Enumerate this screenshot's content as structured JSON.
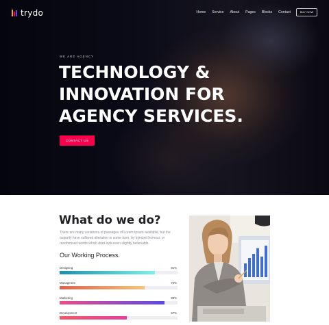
{
  "brand": {
    "name": "trydo",
    "mark_colors": [
      "#f5a524",
      "#f9004d",
      "#6a3cff"
    ]
  },
  "nav": {
    "items": [
      "Home",
      "Service",
      "About",
      "Pages",
      "Blocks",
      "Contact"
    ],
    "cta": "BUY NOW"
  },
  "hero": {
    "eyebrow": "WE ARE AGENCY",
    "title_lines": [
      "TECHNOLOGY &",
      "INNOVATION FOR",
      "AGENCY SERVICES."
    ],
    "button": "CONTACT US"
  },
  "about": {
    "title": "What do we do?",
    "description": "There are many variations of passages of Lorem Ipsum available, but the majority have suffered alteration in some form, by injected humour, or randomised words which dont look even slightly believable.",
    "process_title": "Our Working Process.",
    "skills": [
      {
        "label": "Designing",
        "percent": 81,
        "percent_text": "81%",
        "from": "#1d8fb0",
        "to": "#7ef0e6"
      },
      {
        "label": "Managment",
        "percent": 72,
        "percent_text": "72%",
        "from": "#e0604c",
        "to": "#f3c57c"
      },
      {
        "label": "Marketing",
        "percent": 89,
        "percent_text": "89%",
        "from": "#ee4d8a",
        "to": "#5a49e6"
      },
      {
        "label": "Development",
        "percent": 57,
        "percent_text": "57%",
        "from": "#f15a63",
        "to": "#e83e9e"
      }
    ]
  },
  "colors": {
    "accent": "#f9004d",
    "heading": "#1f1f25",
    "hero_bg": "#0b0b18"
  }
}
